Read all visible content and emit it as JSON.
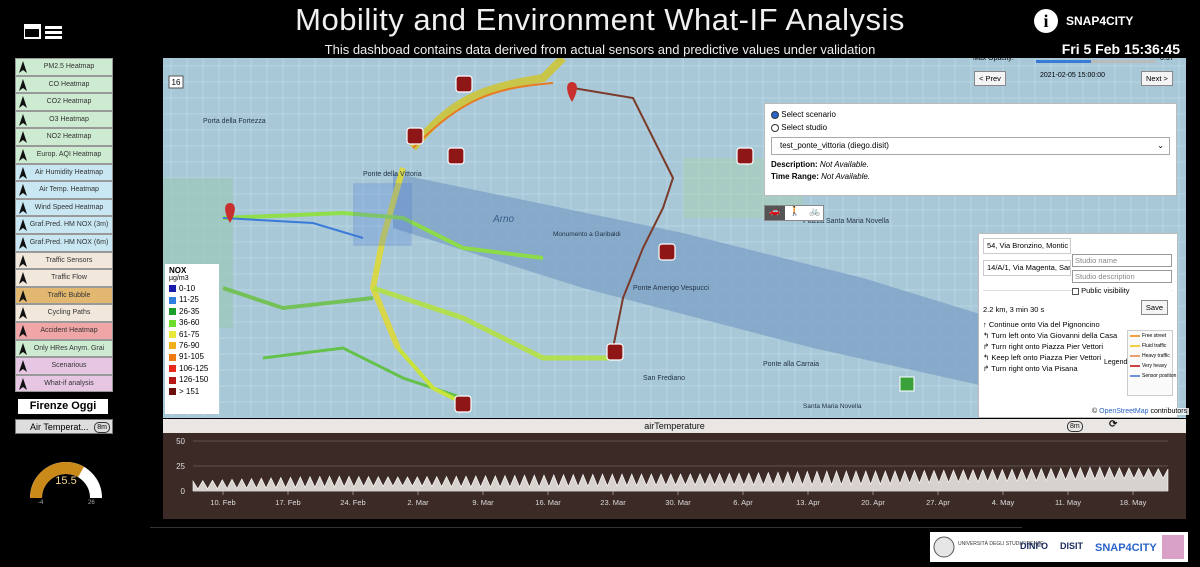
{
  "header": {
    "title": "Mobility and Environment What-IF Analysis",
    "subtitle": "This dashboad contains data derived from actual sensors and predictive values under validation",
    "clock": "Fri 5 Feb 15:36:45",
    "info_icon": "i",
    "logo_text": "SNAP4CITY"
  },
  "sidebar": {
    "items": [
      {
        "label": "PM2.5 Heatmap",
        "color": "#cdebd0",
        "icon": "navigation-arrow-icon"
      },
      {
        "label": "CO Heatmap",
        "color": "#cdebd0",
        "icon": "navigation-arrow-icon"
      },
      {
        "label": "CO2 Heatmap",
        "color": "#cdebd0",
        "icon": "navigation-arrow-icon"
      },
      {
        "label": "O3 Heatmap",
        "color": "#cdebd0",
        "icon": "navigation-arrow-icon"
      },
      {
        "label": "NO2 Heatmap",
        "color": "#cdebd0",
        "icon": "navigation-arrow-icon"
      },
      {
        "label": "Europ. AQI Heatmap",
        "color": "#cdebd0",
        "icon": "navigation-arrow-icon"
      },
      {
        "label": "Air Humidity Heatmap",
        "color": "#c8e7f3",
        "icon": "navigation-arrow-icon"
      },
      {
        "label": "Air Temp. Heatmap",
        "color": "#c8e7f3",
        "icon": "navigation-arrow-icon"
      },
      {
        "label": "Wind Speed Heatmap",
        "color": "#c8e7f3",
        "icon": "navigation-arrow-icon"
      },
      {
        "label": "Graf.Pred. HM NOX (3m)",
        "color": "#c8e7f3",
        "icon": "navigation-arrow-icon"
      },
      {
        "label": "Graf.Pred. HM NOX (6m)",
        "color": "#c8e7f3",
        "icon": "navigation-arrow-icon"
      },
      {
        "label": "Traffic Sensors",
        "color": "#f1e7da",
        "icon": "navigation-arrow-icon"
      },
      {
        "label": "Traffic Flow",
        "color": "#f1e7da",
        "icon": "navigation-arrow-icon"
      },
      {
        "label": "Traffic Bubble",
        "color": "#e2b870",
        "icon": "navigation-arrow-icon"
      },
      {
        "label": "Cycling Paths",
        "color": "#f1e7da",
        "icon": "navigation-arrow-icon"
      },
      {
        "label": "Accident Heatmap",
        "color": "#f0a6a6",
        "icon": "navigation-arrow-icon"
      },
      {
        "label": "Only HRes Anym. Grai",
        "color": "#cdebd0",
        "icon": "navigation-arrow-icon"
      },
      {
        "label": "Scenarious",
        "color": "#e6c6e3",
        "icon": "navigation-arrow-icon"
      },
      {
        "label": "What-if analysis",
        "color": "#e6c6e3",
        "icon": "navigation-arrow-icon"
      }
    ]
  },
  "left_widgets": {
    "city_label": "Firenze Oggi",
    "airtemp_tab": "Air Temperat...",
    "airtemp_badge": "8m",
    "gauge_value": "15.5",
    "gauge_min": "-4",
    "gauge_max": "26"
  },
  "map": {
    "zoom_label": "16",
    "opacity_label": "Max Opacity:",
    "opacity_value": "0.37",
    "datetime": "2021-02-05 15:00:00",
    "prev_button": "< Prev",
    "next_button": "Next >",
    "labels": [
      {
        "text": "Porta della Fortezza",
        "x": 0
      },
      {
        "text": "Arno",
        "x": 0
      }
    ],
    "place_labels": [
      "Piazza Santa Maria Novella",
      "Ponte Amerigo Vespucci",
      "Ponte alla Carraia",
      "San Frediano",
      "Ponte della Vittoria",
      "Monumento a Garibaldi",
      "Santa Maria Novella"
    ],
    "attribution_prefix": "©",
    "attribution_link": "OpenStreetMap",
    "attribution_suffix": "contributors"
  },
  "legend": {
    "title": "NOX",
    "unit": "µg/m3",
    "items": [
      {
        "label": "0-10",
        "color": "#1a1aa8"
      },
      {
        "label": "11-25",
        "color": "#2e7fe0"
      },
      {
        "label": "26-35",
        "color": "#1c9e2a"
      },
      {
        "label": "36-60",
        "color": "#6ddc2b"
      },
      {
        "label": "61-75",
        "color": "#e8e83a"
      },
      {
        "label": "76-90",
        "color": "#f0b01c"
      },
      {
        "label": "91-105",
        "color": "#f07a16"
      },
      {
        "label": "106-125",
        "color": "#e8281a"
      },
      {
        "label": "126-150",
        "color": "#b51616"
      },
      {
        "label": "> 151",
        "color": "#6e0f0f"
      }
    ]
  },
  "scenario": {
    "option1": "Select scenario",
    "option2": "Select studio",
    "selected": "test_ponte_vittoria (diego.disit)",
    "description_label": "Description:",
    "description_value": "Not Available.",
    "timerange_label": "Time Range:",
    "timerange_value": "Not Available.",
    "modes": [
      "car-icon",
      "walk-icon",
      "bike-icon"
    ]
  },
  "route": {
    "from": "54, Via Bronzino, Montic",
    "to": "14/A/1, Via Magenta, San",
    "summary": "2.2 km, 3 min 30 s",
    "steps": [
      "Continue onto Via del Pignoncino",
      "Turn left onto Via Giovanni della Casa",
      "Turn right onto Piazza Pier Vettori",
      "Keep left onto Piazza Pier Vettori",
      "Turn right onto Via Pisana"
    ],
    "legend_label": "Legend",
    "studio_name_placeholder": "Studio name",
    "studio_desc_placeholder": "Studio description",
    "public_label": "Public visibility",
    "save_label": "Save",
    "traffic_legend": [
      "Free street",
      "Fluid traffic",
      "Heavy traffic",
      "Very heavy",
      "Sensor position"
    ]
  },
  "chart_panel": {
    "title": "airTemperature",
    "badge": "8m",
    "refresh_icon": "refresh-icon"
  },
  "chart_data": {
    "type": "area",
    "title": "airTemperature",
    "ylim": [
      0,
      50
    ],
    "yticks": [
      0,
      25,
      50
    ],
    "xticks": [
      "10. Feb",
      "17. Feb",
      "24. Feb",
      "2. Mar",
      "9. Mar",
      "16. Mar",
      "23. Mar",
      "30. Mar",
      "6. Apr",
      "13. Apr",
      "20. Apr",
      "27. Apr",
      "4. May",
      "11. May",
      "18. May"
    ],
    "series": [
      {
        "values_min": [
          2,
          3,
          4,
          5,
          4,
          4,
          5,
          6,
          6,
          6,
          7,
          9,
          10,
          12,
          13
        ],
        "values_max": [
          10,
          13,
          15,
          14,
          15,
          16,
          17,
          17,
          18,
          20,
          20,
          21,
          22,
          24,
          22
        ]
      }
    ]
  },
  "footer": {
    "logos": [
      "UNIVERSITÀ DEGLI STUDI FIRENZE",
      "DINFO",
      "DISIT",
      "SNAP4CITY"
    ]
  }
}
